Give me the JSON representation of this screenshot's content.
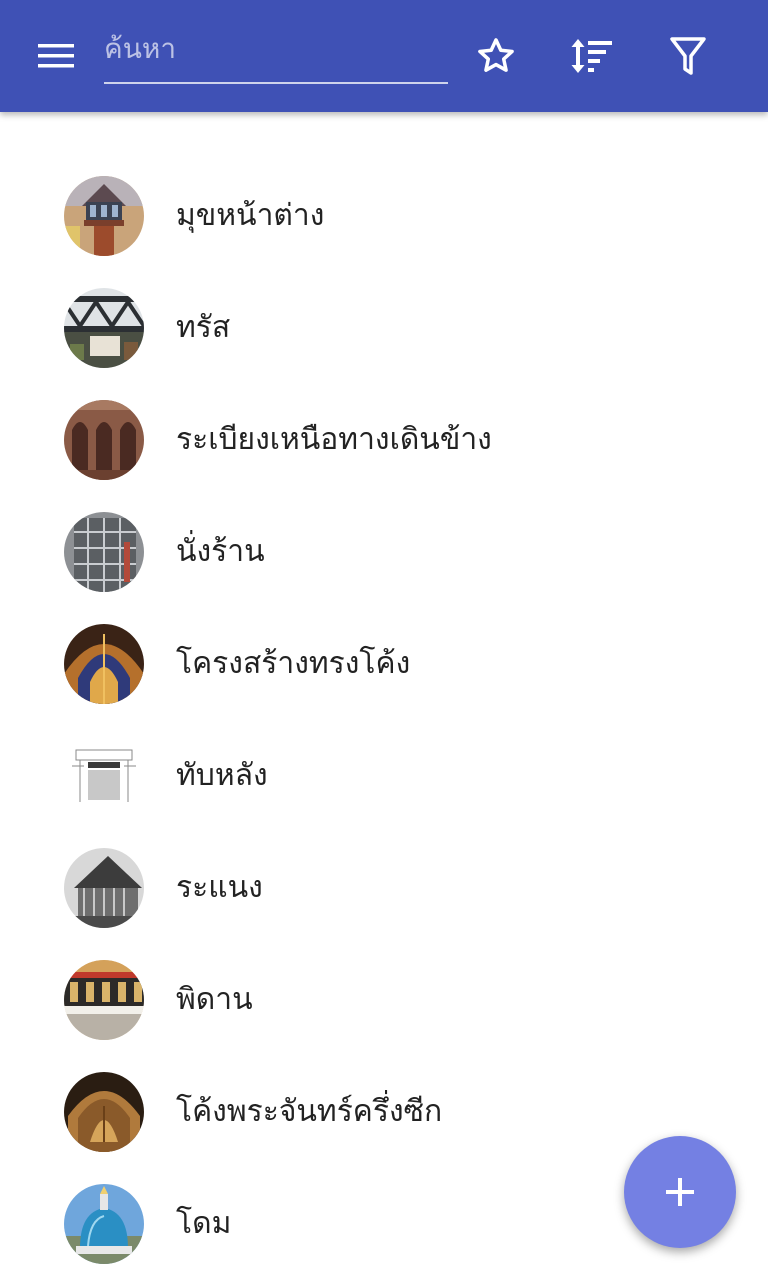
{
  "toolbar": {
    "menu_icon": "menu-icon",
    "search_placeholder": "ค้นหา",
    "search_value": "",
    "favorites_icon": "star-outline-icon",
    "sort_icon": "sort-icon",
    "filter_icon": "filter-icon",
    "color": "#3f51b5"
  },
  "items": [
    {
      "label": "มุขหน้าต่าง"
    },
    {
      "label": "ทรัส"
    },
    {
      "label": "ระเบียงเหนือทางเดินข้าง"
    },
    {
      "label": "นั่งร้าน"
    },
    {
      "label": "โครงสร้างทรงโค้ง"
    },
    {
      "label": "ทับหลัง"
    },
    {
      "label": "ระแนง"
    },
    {
      "label": "พิดาน"
    },
    {
      "label": "โค้งพระจันทร์ครึ่งซีก"
    },
    {
      "label": "โดม"
    }
  ],
  "fab": {
    "icon": "plus-icon",
    "color": "#7480e3"
  }
}
